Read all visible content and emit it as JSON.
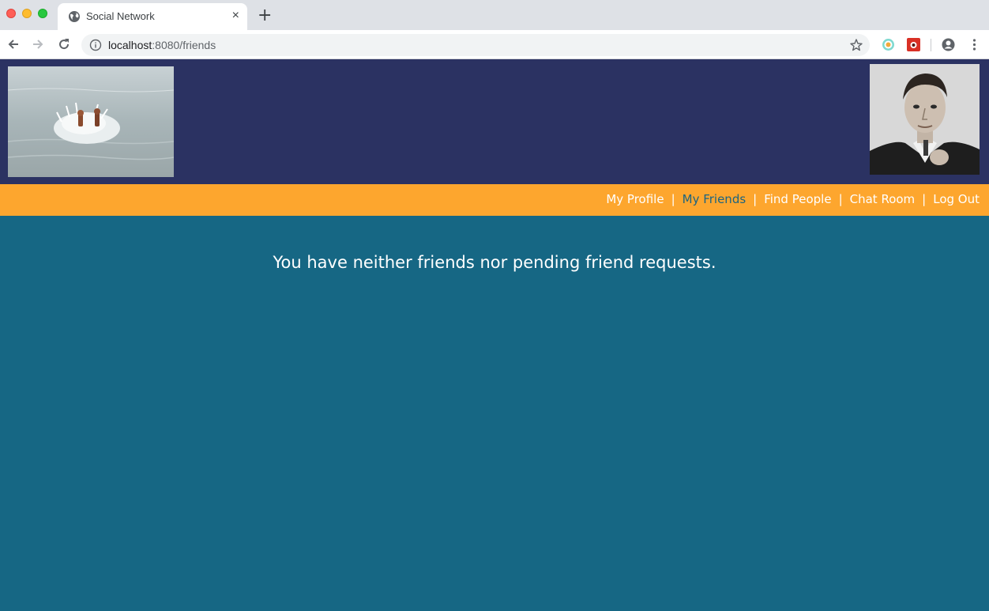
{
  "browser": {
    "tab_title": "Social Network",
    "close_symbol": "×",
    "new_tab_symbol": "+",
    "url_host": "localhost",
    "url_path": ":8080/friends"
  },
  "nav": {
    "items": [
      {
        "label": "My Profile",
        "active": false
      },
      {
        "label": "My Friends",
        "active": true
      },
      {
        "label": "Find People",
        "active": false
      },
      {
        "label": "Chat Room",
        "active": false
      },
      {
        "label": "Log Out",
        "active": false
      }
    ],
    "separator": "|"
  },
  "main": {
    "message": "You have neither friends nor pending friend requests."
  },
  "colors": {
    "header_bg": "#2b3262",
    "nav_bg": "#fda62e",
    "page_bg": "#166784",
    "active_link": "#1c6480"
  },
  "icons": {
    "tab": "globe-icon",
    "back": "arrow-left-icon",
    "forward": "arrow-right-icon",
    "reload": "reload-icon",
    "info": "info-icon",
    "bookmark": "star-icon",
    "profile": "account-icon",
    "menu": "kebab-menu-icon"
  }
}
